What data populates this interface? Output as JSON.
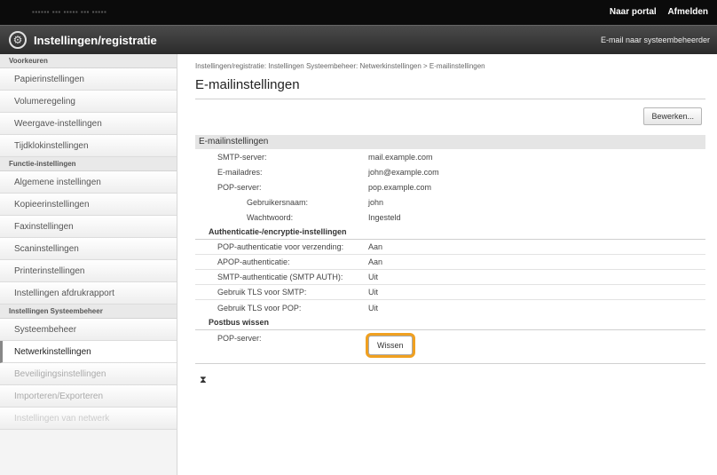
{
  "topbar": {
    "device": "▪▪▪▪▪▪ ▪▪▪ ▪▪▪▪▪ ▪▪▪ ▪▪▪▪▪",
    "links": [
      "Naar portal",
      "Afmelden"
    ]
  },
  "header": {
    "title": "Instellingen/registratie",
    "right_link": "E-mail naar systeembeheerder"
  },
  "sidebar": {
    "sections": [
      {
        "heading": "Voorkeuren",
        "items": [
          "Papierinstellingen",
          "Volumeregeling",
          "Weergave-instellingen",
          "Tijdklokinstellingen"
        ]
      },
      {
        "heading": "Functie-instellingen",
        "items": [
          "Algemene instellingen",
          "Kopieerinstellingen",
          "Faxinstellingen",
          "Scaninstellingen",
          "Printerinstellingen",
          "Instellingen afdrukrapport"
        ]
      },
      {
        "heading": "Instellingen Systeembeheer",
        "items": [
          "Systeembeheer",
          "Netwerkinstellingen",
          "Beveiligingsinstellingen",
          "Importeren/Exporteren",
          "Instellingen van netwerk"
        ]
      }
    ],
    "active": "Netwerkinstellingen"
  },
  "main": {
    "breadcrumb": "Instellingen/registratie: Instellingen Systeembeheer: Netwerkinstellingen > E-mailinstellingen",
    "title": "E-mailinstellingen",
    "edit_button": "Bewerken...",
    "section_title": "E-mailinstellingen",
    "rows": [
      {
        "label": "SMTP-server:",
        "value": "mail.example.com"
      },
      {
        "label": "E-mailadres:",
        "value": "john@example.com"
      },
      {
        "label": "POP-server:",
        "value": "pop.example.com"
      },
      {
        "label": "Gebruikersnaam:",
        "value": "john"
      },
      {
        "label": "Wachtwoord:",
        "value": "Ingesteld"
      }
    ],
    "auth_heading": "Authenticatie-/encryptie-instellingen",
    "auth_rows": [
      {
        "label": "POP-authenticatie voor verzending:",
        "value": "Aan"
      },
      {
        "label": "APOP-authenticatie:",
        "value": "Aan"
      },
      {
        "label": "SMTP-authenticatie (SMTP AUTH):",
        "value": "Uit"
      },
      {
        "label": "Gebruik TLS voor SMTP:",
        "value": "Uit"
      },
      {
        "label": "Gebruik TLS voor POP:",
        "value": "Uit"
      }
    ],
    "postbox_heading": "Postbus wissen",
    "postbox_label": "POP-server:",
    "postbox_button": "Wissen",
    "top_link": "⧗"
  },
  "colors": {
    "highlight": "#f0a020",
    "topbar": "#0b0b0b"
  }
}
